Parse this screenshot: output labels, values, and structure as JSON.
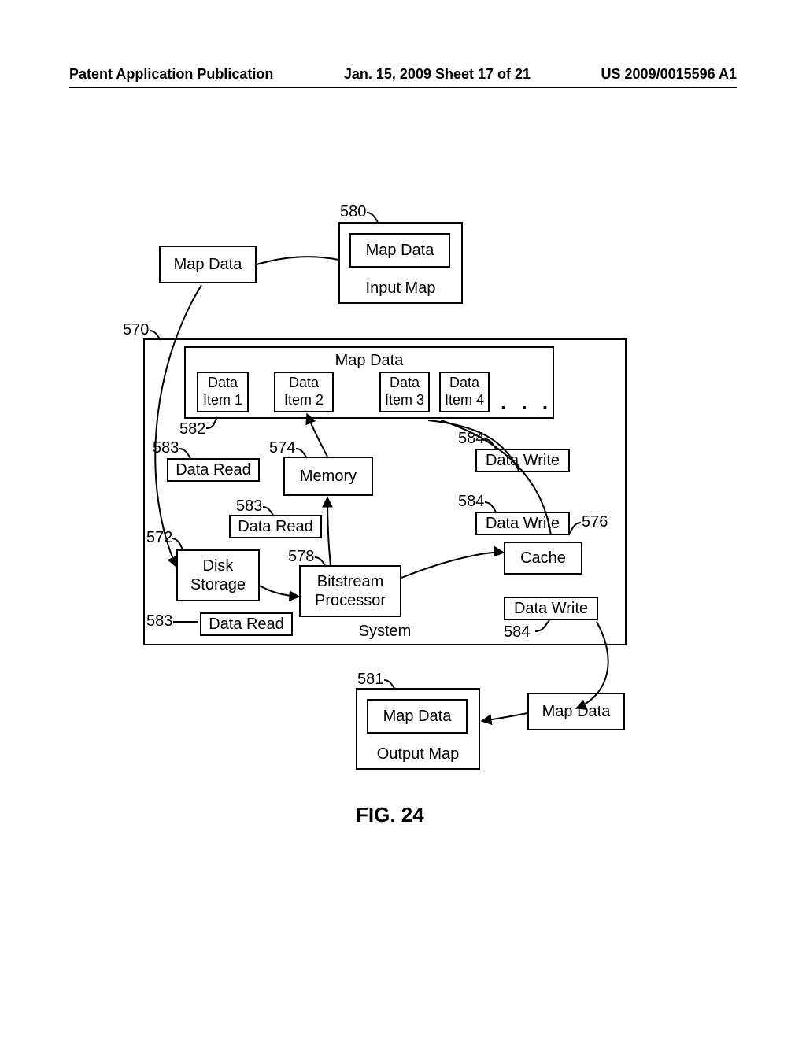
{
  "header": {
    "left": "Patent Application Publication",
    "center": "Jan. 15, 2009  Sheet 17 of 21",
    "right": "US 2009/0015596 A1"
  },
  "figure_caption": "FIG. 24",
  "refs": {
    "r570": "570",
    "r572": "572",
    "r574": "574",
    "r576": "576",
    "r578": "578",
    "r580": "580",
    "r581": "581",
    "r582": "582",
    "r583a": "583",
    "r583b": "583",
    "r583c": "583",
    "r584a": "584",
    "r584b": "584",
    "r584c": "584"
  },
  "boxes": {
    "map_data_tl": "Map Data",
    "input_map_inner": "Map Data",
    "input_map_label": "Input Map",
    "map_data_band": "Map Data",
    "item1": "Data\nItem 1",
    "item2": "Data\nItem 2",
    "item3": "Data\nItem 3",
    "item4": "Data\nItem 4",
    "data_read_1": "Data Read",
    "data_read_2": "Data Read",
    "data_read_3": "Data Read",
    "memory": "Memory",
    "data_write_1": "Data Write",
    "data_write_2": "Data Write",
    "data_write_3": "Data Write",
    "cache": "Cache",
    "disk_storage": "Disk\nStorage",
    "bitstream_processor": "Bitstream\nProcessor",
    "system_label": "System",
    "output_map_inner": "Map Data",
    "output_map_label": "Output Map",
    "map_data_br": "Map Data"
  },
  "ellipsis": ". . ."
}
